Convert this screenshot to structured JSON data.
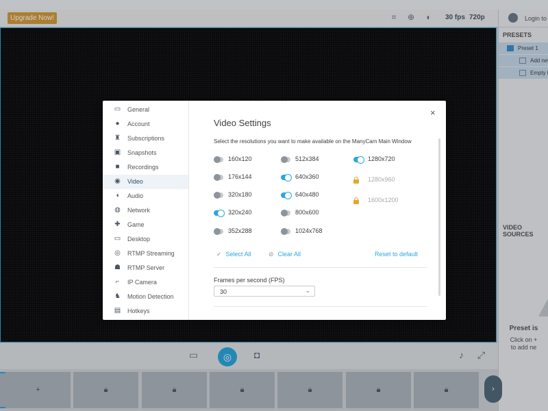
{
  "app": {
    "upgrade_label": "Upgrade Now!",
    "fps": "30 fps",
    "resolution": "720p",
    "login_label": "Login to M",
    "presets_header": "PRESETS",
    "preset_name": "Preset 1",
    "add_new_label": "Add new",
    "empty_label": "Empty l",
    "video_sources_header": "VIDEO SOURCES",
    "preset_msg_title": "Preset is",
    "preset_msg_line1": "Click on +",
    "preset_msg_line2": "to add ne",
    "add_thumb_label": "+"
  },
  "dialog": {
    "title": "Video Settings",
    "subtitle": "Select the resolutions you want to make available on the ManyCam Main Window",
    "close_label": "×",
    "menu": [
      {
        "label": "General",
        "icon": "window-icon"
      },
      {
        "label": "Account",
        "icon": "user-icon"
      },
      {
        "label": "Subscriptions",
        "icon": "subscriptions-icon"
      },
      {
        "label": "Snapshots",
        "icon": "image-icon"
      },
      {
        "label": "Recordings",
        "icon": "video-camera-icon"
      },
      {
        "label": "Video",
        "icon": "webcam-icon",
        "selected": true
      },
      {
        "label": "Audio",
        "icon": "speaker-icon"
      },
      {
        "label": "Network",
        "icon": "globe-icon"
      },
      {
        "label": "Game",
        "icon": "gamepad-icon"
      },
      {
        "label": "Desktop",
        "icon": "monitor-icon"
      },
      {
        "label": "RTMP Streaming",
        "icon": "broadcast-icon"
      },
      {
        "label": "RTMP Server",
        "icon": "server-icon"
      },
      {
        "label": "IP Camera",
        "icon": "ip-camera-icon"
      },
      {
        "label": "Motion Detection",
        "icon": "running-icon"
      },
      {
        "label": "Hotkeys",
        "icon": "hotkey-icon"
      }
    ],
    "resolutions": {
      "col1": [
        {
          "label": "160x120",
          "on": false
        },
        {
          "label": "176x144",
          "on": false
        },
        {
          "label": "320x180",
          "on": false
        },
        {
          "label": "320x240",
          "on": true
        },
        {
          "label": "352x288",
          "on": false
        }
      ],
      "col2": [
        {
          "label": "512x384",
          "on": false
        },
        {
          "label": "640x360",
          "on": true
        },
        {
          "label": "640x480",
          "on": true
        },
        {
          "label": "800x600",
          "on": false
        },
        {
          "label": "1024x768",
          "on": false
        }
      ],
      "col3": [
        {
          "label": "1280x720",
          "on": true,
          "locked": false
        },
        {
          "label": "1280x960",
          "locked": true
        },
        {
          "label": "1600x1200",
          "locked": true
        }
      ]
    },
    "select_all": "Select All",
    "clear_all": "Clear All",
    "reset_default": "Reset to default",
    "fps_label": "Frames per second (FPS)",
    "fps_value": "30"
  },
  "colors": {
    "accent": "#2aa7df",
    "lock": "#e5a72a",
    "upgrade": "#d29a3c"
  }
}
